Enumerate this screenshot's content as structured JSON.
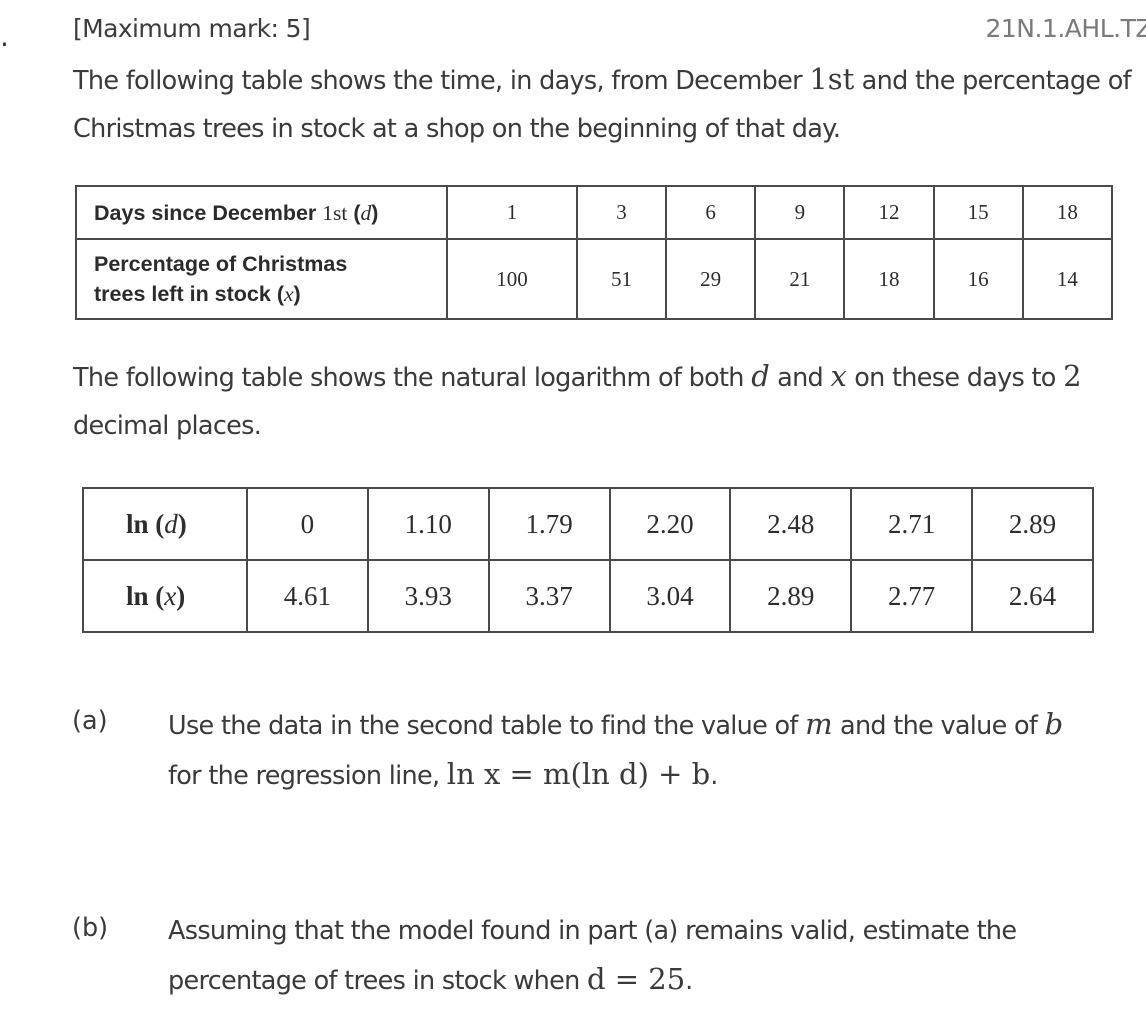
{
  "question": {
    "number_fragment": ".",
    "max_mark": "[Maximum mark: 5]",
    "code": "21N.1.AHL.TZ"
  },
  "intro": {
    "text_before": "The following table shows the time, in days, from December ",
    "math_1st": "1st",
    "text_after": " and the percentage of Christmas trees in stock at a shop on the beginning of that day."
  },
  "table1": {
    "row1_label_text": "Days since December ",
    "row1_label_math": "1st",
    "row1_label_var": "d",
    "row2_label_line1": "Percentage of Christmas",
    "row2_label_line2": "trees left in stock (",
    "row2_label_var": "x",
    "days": [
      "1",
      "3",
      "6",
      "9",
      "12",
      "15",
      "18"
    ],
    "percentages": [
      "100",
      "51",
      "29",
      "21",
      "18",
      "16",
      "14"
    ]
  },
  "log_intro": {
    "text1": "The following table shows the natural logarithm of both ",
    "var_d": "d",
    "text2": " and ",
    "var_x": "x",
    "text3": " on these days to ",
    "num": "2",
    "text4": " decimal places."
  },
  "table2": {
    "row1_label_fn": "ln",
    "row1_label_var": "d",
    "row2_label_fn": "ln",
    "row2_label_var": "x",
    "ln_d": [
      "0",
      "1.10",
      "1.79",
      "2.20",
      "2.48",
      "2.71",
      "2.89"
    ],
    "ln_x": [
      "4.61",
      "3.93",
      "3.37",
      "3.04",
      "2.89",
      "2.77",
      "2.64"
    ]
  },
  "part_a": {
    "label": "(a)",
    "text1": "Use the data in the second table to find the value of ",
    "var_m": "m",
    "text2": " and the value of ",
    "var_b": "b",
    "text3": " for the regression line, ",
    "equation": "ln x = m(ln d) + b",
    "end": "."
  },
  "part_b": {
    "label": "(b)",
    "text1": "Assuming that the model found in part (a) remains valid, estimate the percentage of trees in stock when ",
    "equation": "d = 25",
    "end": "."
  }
}
